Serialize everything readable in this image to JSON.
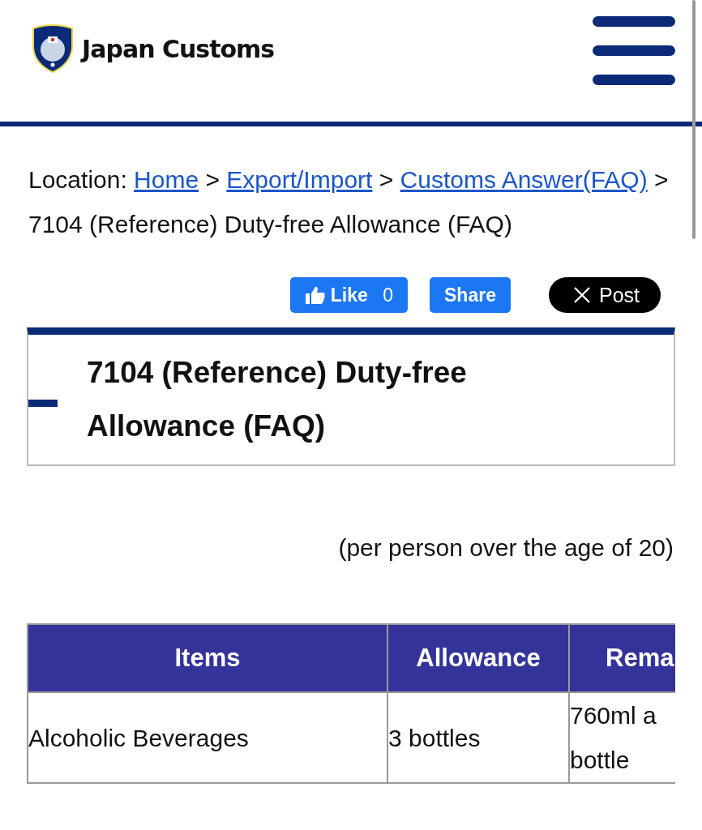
{
  "header": {
    "site_name": "Japan Customs"
  },
  "breadcrumb": {
    "label": "Location:",
    "links": [
      "Home",
      "Export/Import",
      "Customs Answer(FAQ)"
    ],
    "separator": ">",
    "current": "7104 (Reference) Duty-free Allowance (FAQ)"
  },
  "social": {
    "like": {
      "label": "Like",
      "count": "0"
    },
    "share": "Share",
    "post": "Post"
  },
  "page_title": "7104 (Reference) Duty-free Allowance (FAQ)",
  "note": "(per person over the age of 20)",
  "table": {
    "columns": [
      "Items",
      "Allowance",
      "Rema"
    ],
    "rows": [
      [
        "Alcoholic Beverages",
        "3 bottles",
        "760ml a\nbottle"
      ]
    ]
  }
}
